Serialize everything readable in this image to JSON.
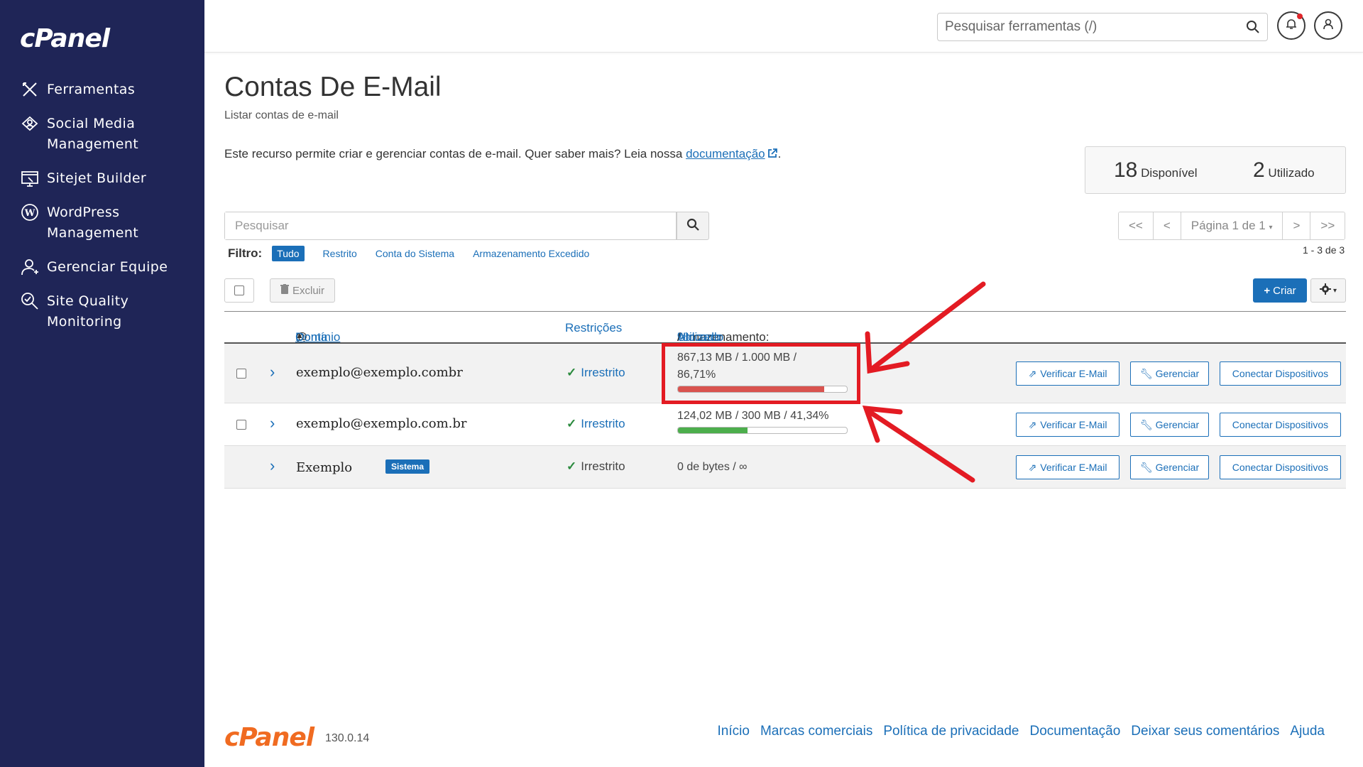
{
  "brand": {
    "logo_text": "cPanel",
    "version": "130.0.14"
  },
  "sidebar": {
    "items": [
      {
        "label": "Ferramentas",
        "icon": "tools-icon"
      },
      {
        "label": "Social Media Management",
        "icon": "social-media-icon"
      },
      {
        "label": "Sitejet Builder",
        "icon": "sitejet-icon"
      },
      {
        "label": "WordPress Management",
        "icon": "wordpress-icon"
      },
      {
        "label": "Gerenciar Equipe",
        "icon": "team-icon"
      },
      {
        "label": "Site Quality Monitoring",
        "icon": "site-quality-icon"
      }
    ]
  },
  "header": {
    "search_placeholder": "Pesquisar ferramentas (/)"
  },
  "page": {
    "title": "Contas De E-Mail",
    "subtitle": "Listar contas de e-mail",
    "description": "Este recurso permite criar e gerenciar contas de e-mail. Quer saber mais? Leia nossa ",
    "doc_link": "documentação",
    "description_end": "."
  },
  "stats": {
    "available_num": "18",
    "available_label": "Disponível",
    "used_num": "2",
    "used_label": "Utilizado"
  },
  "search": {
    "placeholder": "Pesquisar"
  },
  "filter": {
    "label": "Filtro:",
    "options": [
      "Tudo",
      "Restrito",
      "Conta do Sistema",
      "Armazenamento Excedido"
    ],
    "active": "Tudo"
  },
  "pagination": {
    "first": "<<",
    "prev": "<",
    "page_label": "Página 1 de 1",
    "next": ">",
    "last": ">>",
    "range": "1 - 3 de 3"
  },
  "toolbar": {
    "delete_label": "Excluir",
    "create_label": "Criar"
  },
  "table": {
    "headers": {
      "account": "Conta",
      "at": "@",
      "domain": "Domínio",
      "restrictions": "Restrições",
      "storage_prefix": "Armazenamento:",
      "used": "Utilizado",
      "slash1": "/",
      "allocated": "Alocado",
      "slash2": "/",
      "percent": "%"
    },
    "rows": [
      {
        "account": "exemplo@exemplo.combr",
        "restriction": "Irrestrito",
        "storage_line1": "867,13 MB / 1.000 MB /",
        "storage_line2": "86,71%",
        "usage_pct": 86.71,
        "bar_color": "#d9534f"
      },
      {
        "account": "exemplo@exemplo.com.br",
        "restriction": "Irrestrito",
        "storage_line1": "124,02 MB / 300 MB / 41,34%",
        "storage_line2": "",
        "usage_pct": 41.34,
        "bar_color": "#4cae4c"
      },
      {
        "account": "Exemplo",
        "badge": "Sistema",
        "restriction": "Irrestrito",
        "storage_line1": "0 de bytes / ∞",
        "storage_line2": ""
      }
    ],
    "actions": {
      "verify": "Verificar E-Mail",
      "manage": "Gerenciar",
      "connect": "Conectar Dispositivos"
    }
  },
  "footer": {
    "links": [
      "Início",
      "Marcas comerciais",
      "Política de privacidade",
      "Documentação",
      "Deixar seus comentários",
      "Ajuda"
    ]
  },
  "colors": {
    "sidebar_bg": "#1f2557",
    "accent": "#1b6fb8",
    "annotation": "#e31b23",
    "footer_logo": "#f06b21"
  }
}
